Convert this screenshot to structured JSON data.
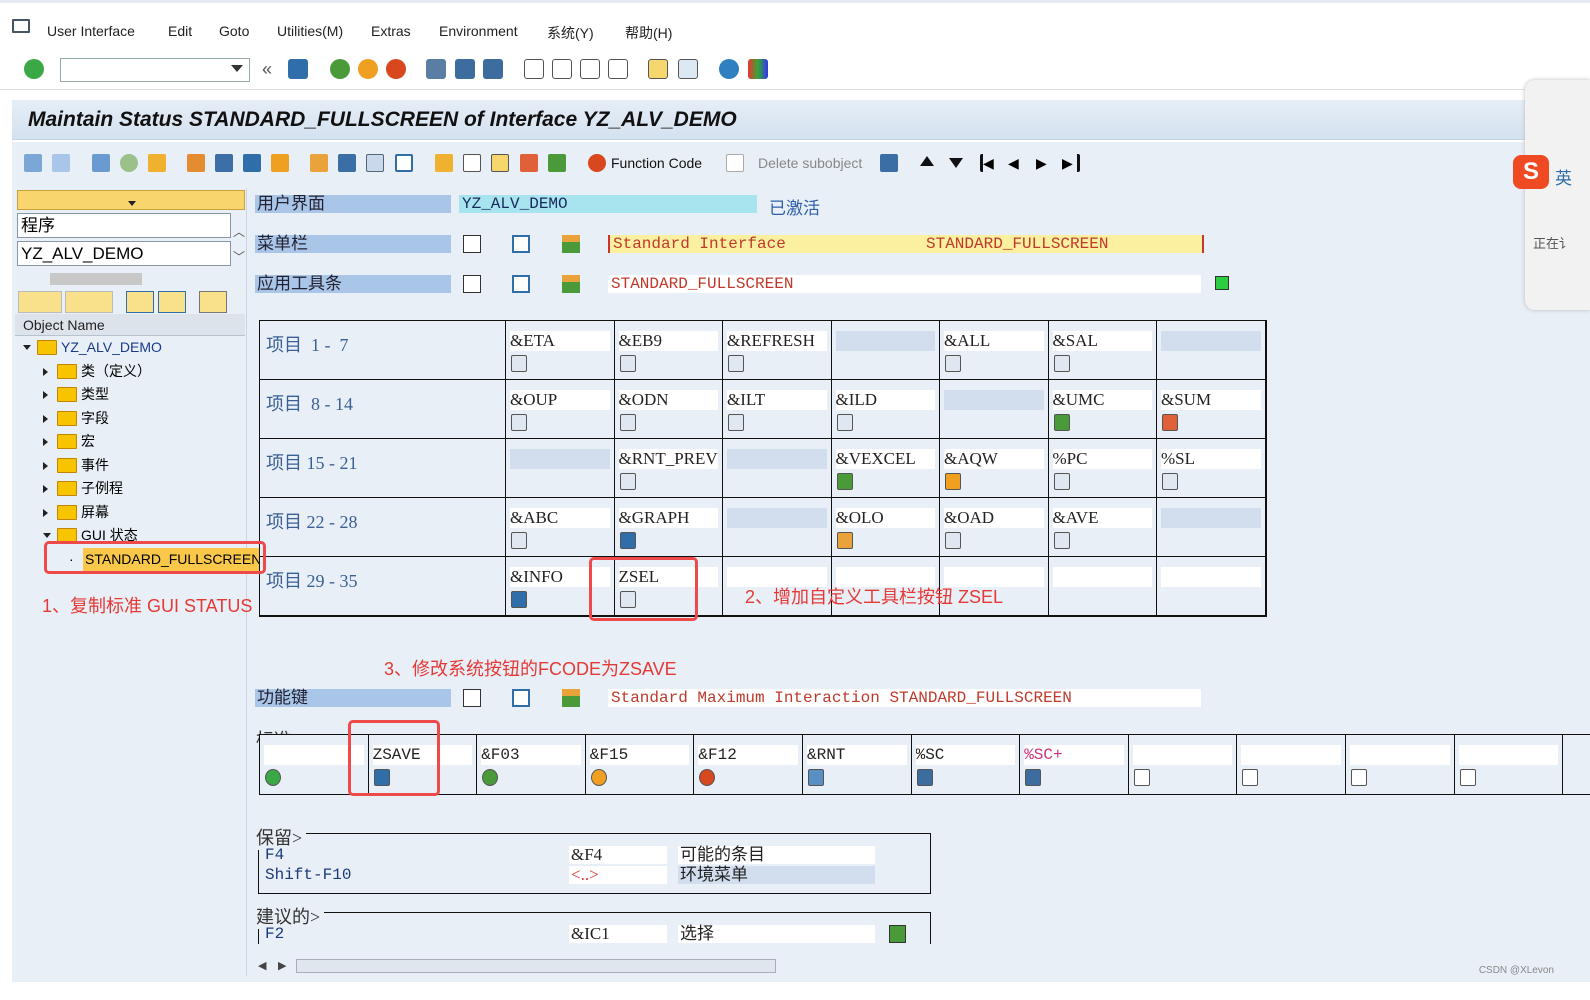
{
  "menubar": {
    "items": [
      "User Interface",
      "Edit",
      "Goto",
      "Utilities(M)",
      "Extras",
      "Environment",
      "系统(Y)",
      "帮助(H)"
    ]
  },
  "title": "Maintain Status STANDARD_FULLSCREEN of Interface YZ_ALV_DEMO",
  "app_toolbar": {
    "function_code": "Function Code",
    "delete_subobject": "Delete subobject"
  },
  "left": {
    "dropdown_label": "程序",
    "program": "YZ_ALV_DEMO",
    "column_header": "Object Name",
    "tree": [
      {
        "label": "YZ_ALV_DEMO",
        "level": 0,
        "expanded": true
      },
      {
        "label": "类（定义）",
        "level": 1
      },
      {
        "label": "类型",
        "level": 1
      },
      {
        "label": "字段",
        "level": 1
      },
      {
        "label": "宏",
        "level": 1
      },
      {
        "label": "事件",
        "level": 1
      },
      {
        "label": "子例程",
        "level": 1
      },
      {
        "label": "屏幕",
        "level": 1
      },
      {
        "label": "GUI 状态",
        "level": 1,
        "expanded": true
      },
      {
        "label": "STANDARD_FULLSCREEN",
        "level": 2,
        "selected": true
      }
    ]
  },
  "fields": {
    "ui": {
      "label": "用户界面",
      "value": "YZ_ALV_DEMO",
      "status": "已激活"
    },
    "menubar": {
      "label": "菜单栏",
      "value": "Standard Interface",
      "value2": "STANDARD_FULLSCREEN"
    },
    "apptoolbar": {
      "label": "应用工具条",
      "value": "STANDARD_FULLSCREEN"
    },
    "fkeys": {
      "label": "功能键",
      "value": "Standard Maximum Interaction STANDARD_FULLSCREEN"
    }
  },
  "items_grid": [
    {
      "label": "项目  1 -  7",
      "cells": [
        {
          "code": "&ETA",
          "icon": "find-detail-icon"
        },
        {
          "code": "&EB9",
          "icon": "bar-chart-icon"
        },
        {
          "code": "&REFRESH",
          "icon": "refresh-icon"
        },
        {
          "code": ""
        },
        {
          "code": "&ALL",
          "icon": "select-all-icon"
        },
        {
          "code": "&SAL",
          "icon": "deselect-all-icon"
        },
        {
          "code": ""
        }
      ]
    },
    {
      "label": "项目  8 - 14",
      "cells": [
        {
          "code": "&OUP",
          "icon": "sort-up-icon"
        },
        {
          "code": "&ODN",
          "icon": "sort-down-icon"
        },
        {
          "code": "&ILT",
          "icon": "filter-icon"
        },
        {
          "code": "&ILD",
          "icon": "delete-filter-icon"
        },
        {
          "code": ""
        },
        {
          "code": "&UMC",
          "icon": "sum-icon"
        },
        {
          "code": "&SUM",
          "icon": "subtotal-icon"
        }
      ]
    },
    {
      "label": "项目 15 - 21",
      "cells": [
        {
          "code": ""
        },
        {
          "code": "&RNT_PREV",
          "icon": "print-preview-icon"
        },
        {
          "code": ""
        },
        {
          "code": "&VEXCEL",
          "icon": "excel-icon"
        },
        {
          "code": "&AQW",
          "icon": "word-icon"
        },
        {
          "code": "%PC",
          "icon": "export-file-icon"
        },
        {
          "code": "%SL",
          "icon": "mail-icon"
        }
      ]
    },
    {
      "label": "项目 22 - 28",
      "cells": [
        {
          "code": "&ABC",
          "icon": "abc-analysis-icon"
        },
        {
          "code": "&GRAPH",
          "icon": "graph-icon"
        },
        {
          "code": ""
        },
        {
          "code": "&OLO",
          "icon": "layout-icon"
        },
        {
          "code": "&OAD",
          "icon": "choose-layout-icon"
        },
        {
          "code": "&AVE",
          "icon": "save-layout-icon"
        },
        {
          "code": ""
        }
      ]
    },
    {
      "label": "项目 29 - 35",
      "cells": [
        {
          "code": "&INFO",
          "icon": "info-icon"
        },
        {
          "code": "ZSEL",
          "icon": "select-icon"
        },
        {
          "code": ""
        },
        {
          "code": ""
        },
        {
          "code": ""
        },
        {
          "code": ""
        },
        {
          "code": ""
        }
      ]
    }
  ],
  "standard_keys": {
    "title": "标准>",
    "cells": [
      {
        "code": "",
        "icon": "check-icon"
      },
      {
        "code": "ZSAVE",
        "icon": "save-icon"
      },
      {
        "code": "&F03",
        "icon": "back-icon"
      },
      {
        "code": "&F15",
        "icon": "exit-icon"
      },
      {
        "code": "&F12",
        "icon": "cancel-icon"
      },
      {
        "code": "&RNT",
        "icon": "print-icon"
      },
      {
        "code": "%SC",
        "icon": "find-icon"
      },
      {
        "code": "%SC+",
        "icon": "find-next-icon"
      },
      {
        "code": "",
        "icon": "first-page-icon"
      },
      {
        "code": "",
        "icon": "previous-page-icon"
      },
      {
        "code": "",
        "icon": "next-page-icon"
      },
      {
        "code": "",
        "icon": "last-page-icon"
      }
    ]
  },
  "reserved": {
    "title": "保留>",
    "rows": [
      {
        "key": "F4",
        "code": "&F4",
        "text": "可能的条目"
      },
      {
        "key": "Shift-F10",
        "code": "<..>",
        "text": "环境菜单"
      }
    ]
  },
  "recommended": {
    "title": "建议的>",
    "rows": [
      {
        "key": "F2",
        "code": "&IC1",
        "text": "选择"
      }
    ]
  },
  "annotations": [
    "1、复制标准 GUI STATUS",
    "2、增加自定义工具栏按钮 ZSEL",
    "3、修改系统按钮的FCODE为ZSAVE"
  ],
  "side_widget": {
    "text1": "英",
    "text2": "正在讠"
  },
  "watermark": "CSDN @XLevon",
  "colors": {
    "accent_label": "#a9c6e8",
    "annotation": "#e53935",
    "background": "#e8eff7"
  }
}
